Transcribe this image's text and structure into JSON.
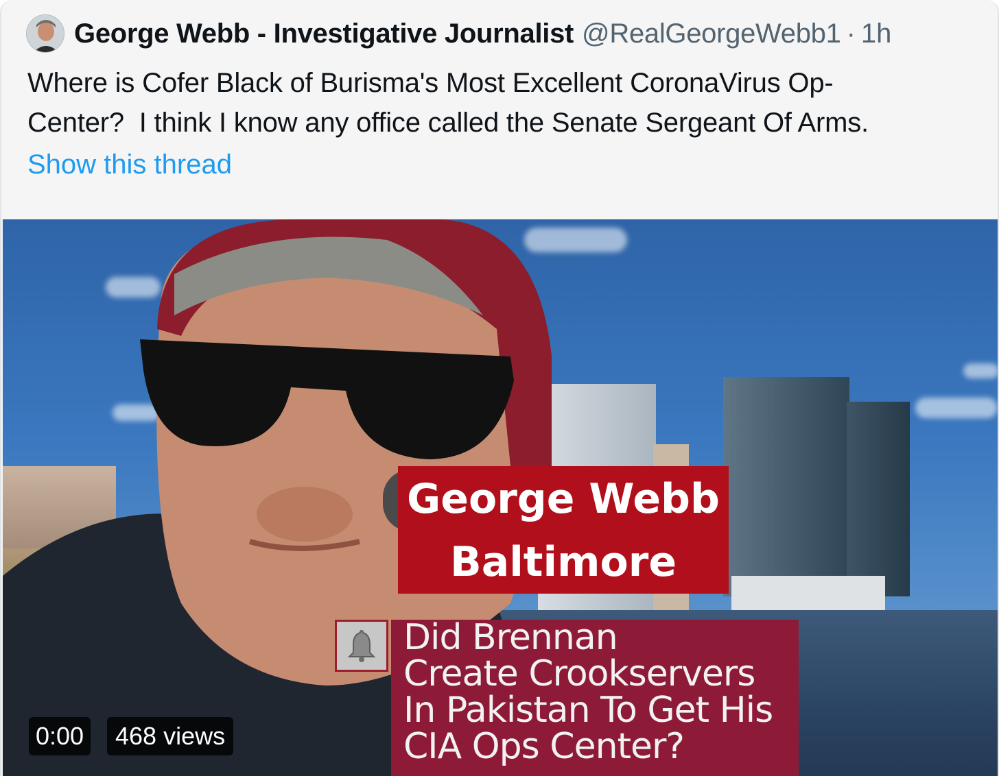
{
  "tweet": {
    "author_name": "George Webb - Investigative Journalist",
    "handle": "@RealGeorgeWebb1",
    "separator": "·",
    "timestamp": "1h",
    "text_lines": [
      "Where is Cofer Black of Burisma's Most Excellent CoronaVirus Op-",
      "Center?  I think I know any office called the Senate Sergeant Of Arms."
    ],
    "show_thread_label": "Show this thread",
    "link_color": "#1d9bf0"
  },
  "video": {
    "name_card": {
      "line1": "George Webb",
      "line2": "Baltimore",
      "color": "#b10f1b"
    },
    "promo": {
      "lines": [
        "Did Brennan",
        "Create Crookservers",
        "In Pakistan To Get His",
        "CIA Ops Center?"
      ],
      "color": "#8d1b37",
      "icon": "bell-icon"
    },
    "duration": "0:00",
    "views": "468 views"
  }
}
